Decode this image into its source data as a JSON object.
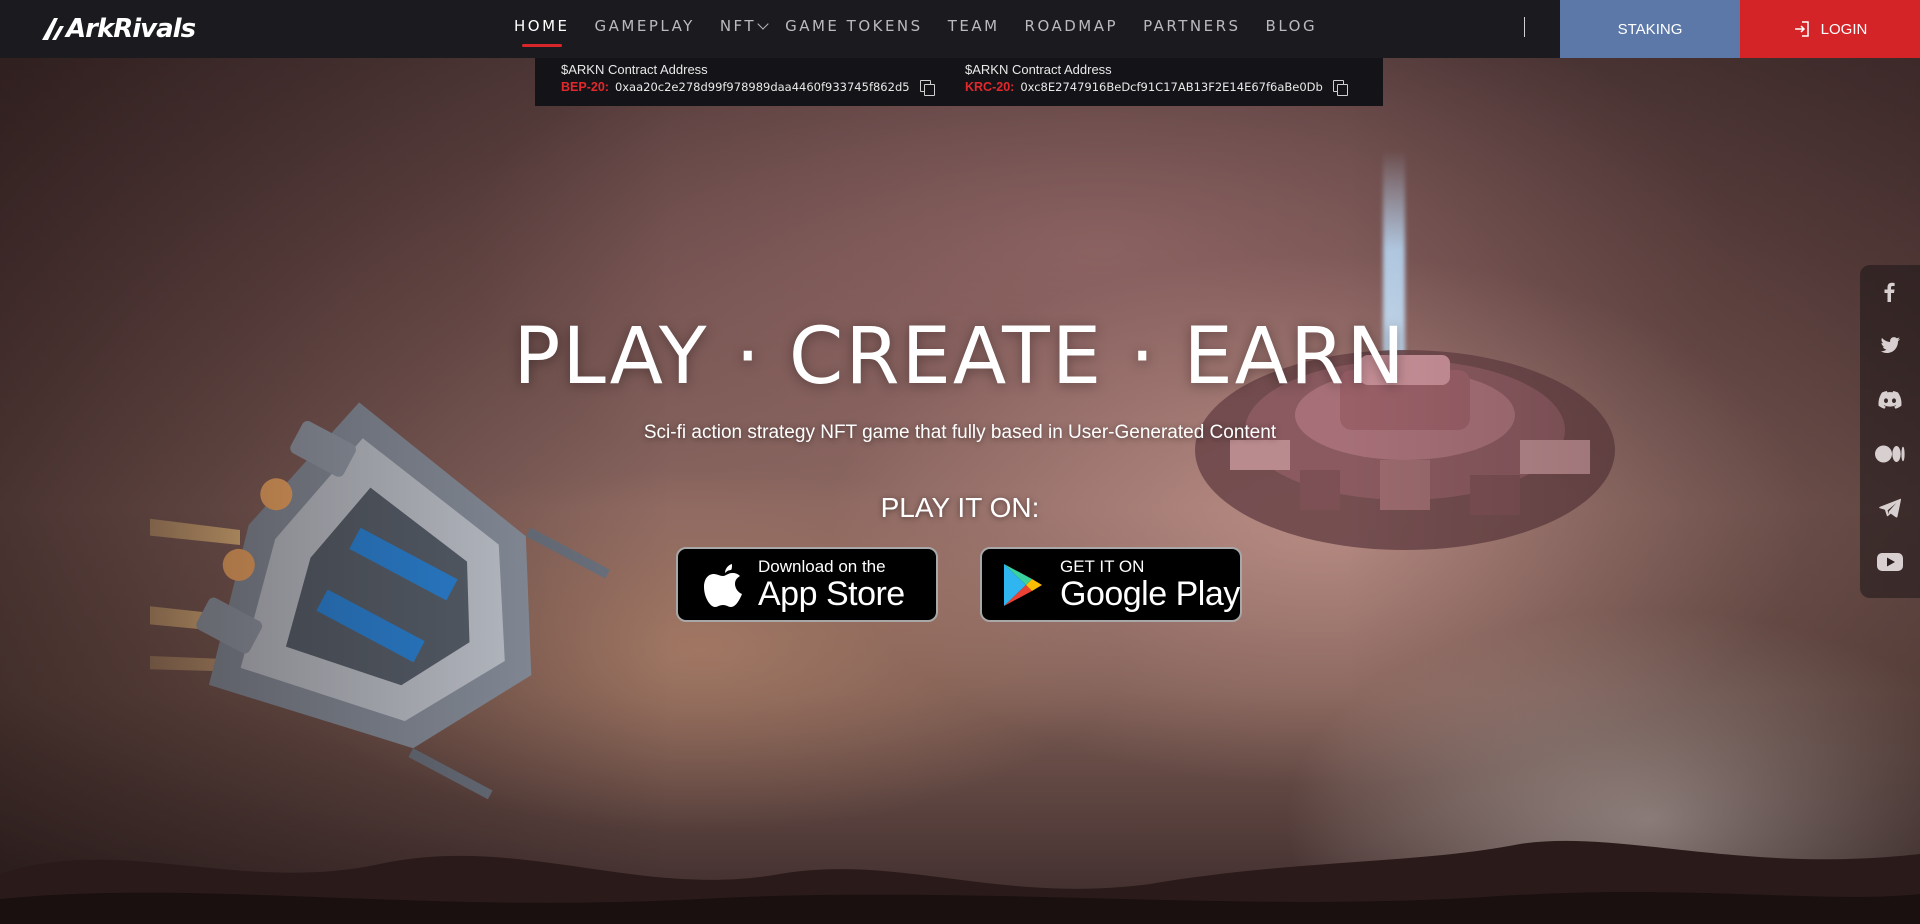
{
  "brand": {
    "logo_text": "ArkRivals"
  },
  "nav": {
    "items": [
      {
        "label": "HOME",
        "active": true
      },
      {
        "label": "GAMEPLAY",
        "active": false
      },
      {
        "label": "NFT",
        "active": false,
        "has_dropdown": true
      },
      {
        "label": "GAME TOKENS",
        "active": false
      },
      {
        "label": "TEAM",
        "active": false
      },
      {
        "label": "ROADMAP",
        "active": false
      },
      {
        "label": "PARTNERS",
        "active": false
      },
      {
        "label": "BLOG",
        "active": false
      }
    ],
    "separator": "|",
    "staking_label": "STAKING",
    "login_label": "LOGIN"
  },
  "contracts": [
    {
      "title": "$ARKN Contract Address",
      "network": "BEP-20:",
      "address": "0xaa20c2e278d99f978989daa4460f933745f862d5"
    },
    {
      "title": "$ARKN Contract Address",
      "network": "KRC-20:",
      "address": "0xc8E2747916BeDcf91C17AB13F2E14E67f6aBe0Db"
    }
  ],
  "hero": {
    "headline": "PLAY · CREATE · EARN",
    "subline": "Sci-fi action strategy NFT game that fully based in User-Generated Content",
    "play_it_on": "PLAY IT ON:"
  },
  "stores": {
    "app_store": {
      "small": "Download on the",
      "big": "App Store",
      "icon": "apple-icon"
    },
    "google_play": {
      "small": "GET IT ON",
      "big": "Google Play",
      "icon": "google-play-icon"
    }
  },
  "social": [
    "facebook-icon",
    "twitter-icon",
    "discord-icon",
    "medium-icon",
    "telegram-icon",
    "youtube-icon"
  ],
  "colors": {
    "header_bg": "#1b1b1f",
    "accent_red": "#d42427",
    "staking_blue": "#5c78a8",
    "contract_network_red": "#e2282c"
  }
}
